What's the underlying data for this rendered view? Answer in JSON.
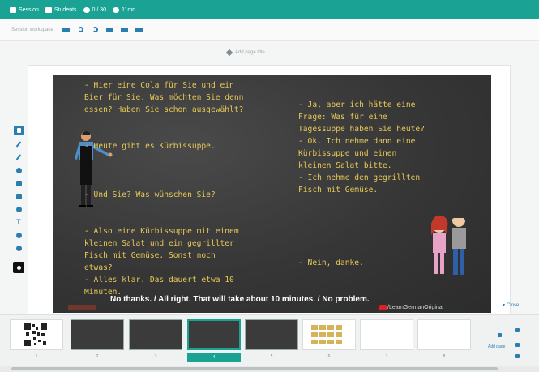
{
  "topbar": {
    "items": [
      {
        "label": "Session",
        "icon": "settings-icon"
      },
      {
        "label": "Students",
        "icon": "monitor-icon"
      },
      {
        "label": "0 / 30",
        "icon": "users-icon"
      },
      {
        "label": "11mn",
        "icon": "clock-icon"
      }
    ]
  },
  "toolbar": {
    "label": "Session workspace",
    "buttons": [
      "folder-icon",
      "undo-icon",
      "redo-icon",
      "duplicate-icon",
      "grid-icon",
      "trash-icon"
    ]
  },
  "page_title": {
    "placeholder": "Add page title"
  },
  "palette": {
    "tools": [
      "select-icon",
      "pen-icon",
      "marker-icon",
      "eraser-icon",
      "shape-icon",
      "list-icon",
      "layers-icon",
      "text-icon",
      "link-icon",
      "refresh-icon"
    ],
    "color": "#111111"
  },
  "slide": {
    "left_text": "- Hier eine Cola für Sie und ein\nBier für Sie. Was möchten Sie denn\nessen? Haben Sie schon ausgewählt?\n\n\n- Heute gibt es Kürbissuppe.\n\n\n\n- Und Sie? Was wünschen Sie?\n\n\n- Also eine Kürbissuppe mit einem\nkleinen Salat und ein gegrillter\nFisch mit Gemüse. Sonst noch\netwas?\n- Alles klar. Das dauert etwa 10\nMinuten.",
    "right_text": "- Ja, aber ich hätte eine\nFrage: Was für eine\nTagessuppe haben Sie heute?\n- Ok. Ich nehme dann eine\nKürbissuppe und einen\nkleinen Salat bitte.\n- Ich nehme den gegrillten\nFisch mit Gemüse.\n\n\n\n\n\n- Nein, danke.",
    "caption": "No thanks. / All right. That will take about 10 minutes. / No problem.",
    "watermark": "/LearnGermanOriginal"
  },
  "close_label": "Close",
  "thumbnails": [
    {
      "num": "1",
      "kind": "qr"
    },
    {
      "num": "2",
      "kind": "dark"
    },
    {
      "num": "3",
      "kind": "dark"
    },
    {
      "num": "4",
      "kind": "dark",
      "active": true
    },
    {
      "num": "5",
      "kind": "dark"
    },
    {
      "num": "6",
      "kind": "grid"
    },
    {
      "num": "7",
      "kind": "blank"
    },
    {
      "num": "8",
      "kind": "blank"
    }
  ],
  "add_page_label": "Add page",
  "colors": {
    "accent": "#1aa394",
    "chalk": "#e6c957",
    "icon_blue": "#2a7fb0"
  }
}
